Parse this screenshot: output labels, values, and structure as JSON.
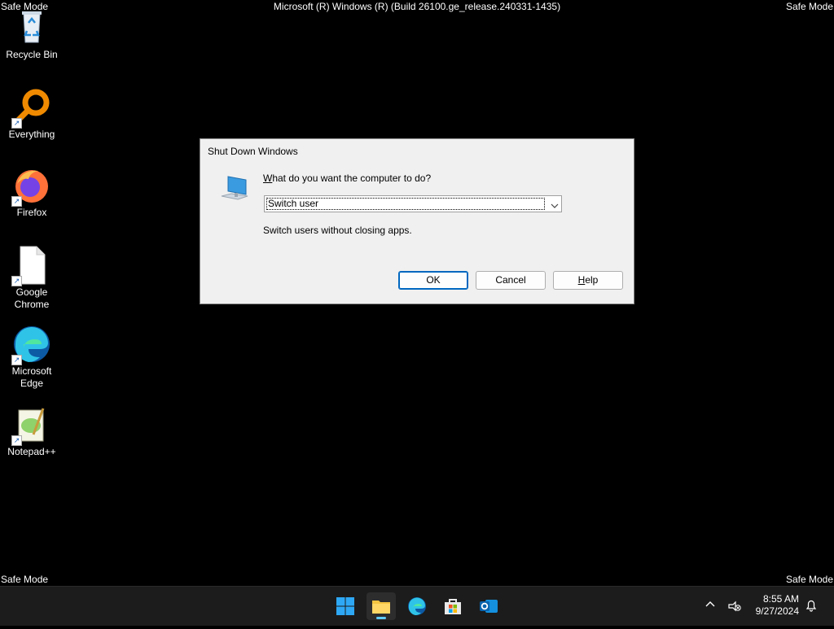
{
  "desktop": {
    "safe_mode_label": "Safe Mode",
    "build_text": "Microsoft (R) Windows (R) (Build 26100.ge_release.240331-1435)",
    "icons": [
      {
        "label": "Recycle Bin",
        "icon": "recycle-bin-icon"
      },
      {
        "label": "Everything",
        "icon": "everything-search-icon"
      },
      {
        "label": "Firefox",
        "icon": "firefox-icon"
      },
      {
        "label": "Google Chrome",
        "icon": "blank-file-icon"
      },
      {
        "label": "Microsoft Edge",
        "icon": "edge-icon"
      },
      {
        "label": "Notepad++",
        "icon": "notepad-plus-plus-icon"
      }
    ]
  },
  "dialog": {
    "title": "Shut Down Windows",
    "question": "What do you want the computer to do?",
    "selected_option": "Switch user",
    "description": "Switch users without closing apps.",
    "ok_label": "OK",
    "cancel_label": "Cancel",
    "help_label": "Help"
  },
  "taskbar": {
    "apps": [
      "start-icon",
      "file-explorer-icon",
      "edge-icon",
      "microsoft-store-icon",
      "outlook-icon"
    ],
    "time": "8:55 AM",
    "date": "9/27/2024"
  },
  "colors": {
    "desktop": "#000000",
    "dialog_bg": "#f0f0f0",
    "accent": "#0067c0",
    "taskbar": "#1c1c1c"
  }
}
